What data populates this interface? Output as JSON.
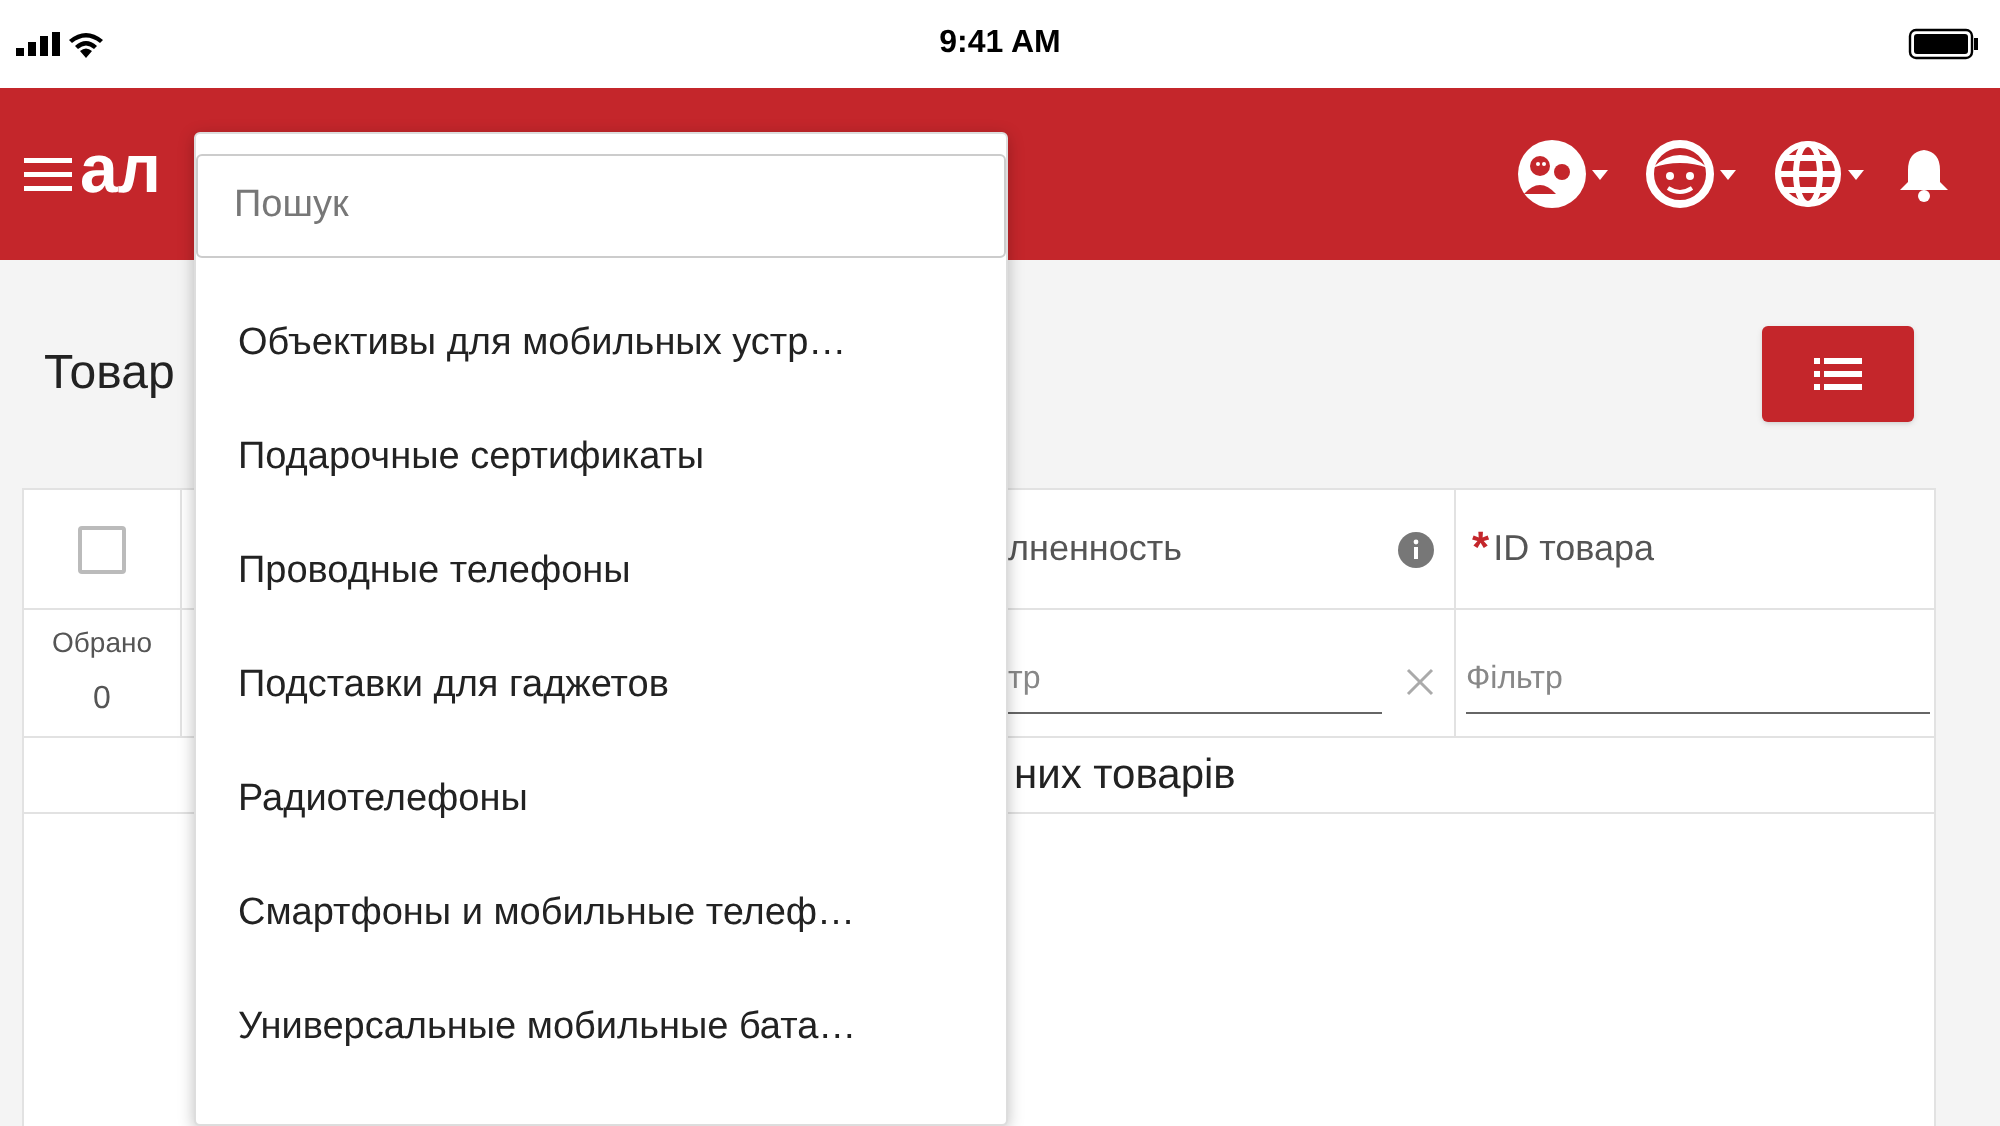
{
  "status_bar": {
    "time": "9:41 AM"
  },
  "header": {
    "logo": "ал"
  },
  "page": {
    "title": "Товар"
  },
  "table": {
    "select_all": {
      "checked": false
    },
    "selected_label": "Обрано",
    "selected_count": "0",
    "columns": [
      {
        "label": "лненность",
        "info": true,
        "filter_placeholder": "тр",
        "clearable": true
      },
      {
        "label": "ID товара",
        "required_mark": "*",
        "info": false,
        "filter_placeholder": "Фільтр",
        "clearable": false
      }
    ],
    "message": "них товарів"
  },
  "dropdown": {
    "search_placeholder": "Пошук",
    "items": [
      {
        "label": "Объективы для мобильных устр…"
      },
      {
        "label": "Подарочные сертификаты"
      },
      {
        "label": "Проводные телефоны"
      },
      {
        "label": "Подставки для гаджетов"
      },
      {
        "label": "Радиотелефоны"
      },
      {
        "label": "Смартфоны и мобильные телеф…"
      },
      {
        "label": "Универсальные мобильные бата…"
      }
    ]
  }
}
